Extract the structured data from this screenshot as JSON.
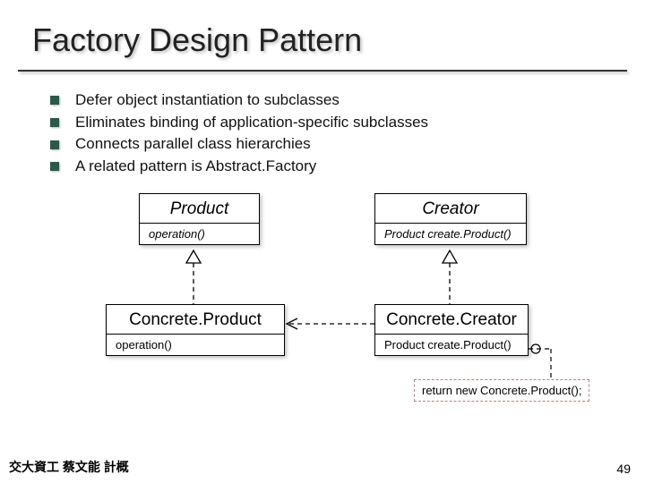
{
  "title": "Factory Design Pattern",
  "bullets": [
    "Defer object instantiation to subclasses",
    "Eliminates binding of application-specific subclasses",
    "Connects parallel class hierarchies",
    "A related pattern is Abstract.Factory"
  ],
  "uml": {
    "product": {
      "name": "Product",
      "op": "operation()"
    },
    "creator": {
      "name": "Creator",
      "op": "Product create.Product()"
    },
    "concreteProduct": {
      "name": "Concrete.Product",
      "op": "operation()"
    },
    "concreteCreator": {
      "name": "Concrete.Creator",
      "op": "Product create.Product()"
    }
  },
  "note": "return new Concrete.Product();",
  "footer": {
    "left": "交大資工 蔡文能 計概",
    "right": "49"
  }
}
